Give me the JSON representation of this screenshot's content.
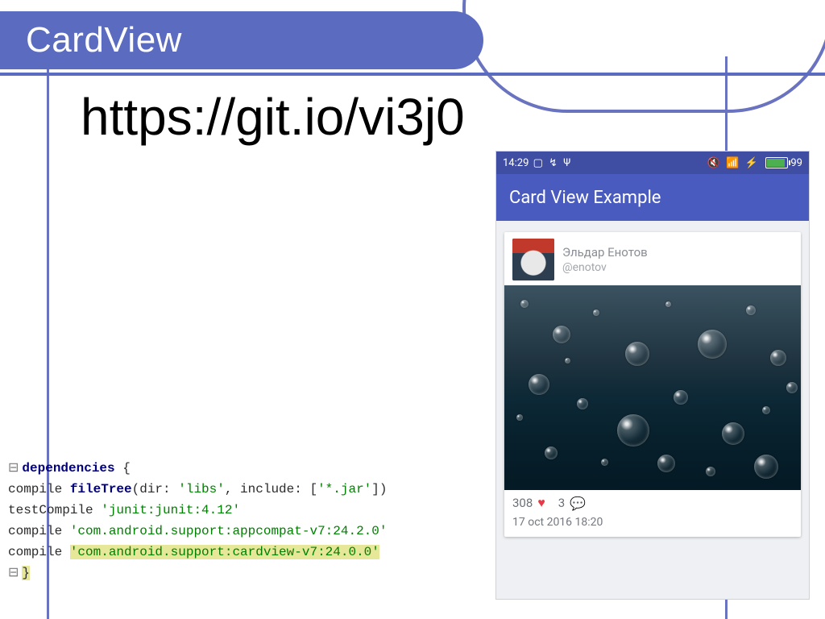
{
  "slide": {
    "title": "CardView",
    "url": "https://git.io/vi3j0"
  },
  "code": {
    "l1a": "dependencies",
    "l1b": " {",
    "l2a": "    compile ",
    "l2b": "fileTree",
    "l2c": "(dir: ",
    "l2d": "'libs'",
    "l2e": ", include: [",
    "l2f": "'*.jar'",
    "l2g": "])",
    "l3a": "    testCompile ",
    "l3b": "'junit:junit:4.12'",
    "l4a": "    compile ",
    "l4b": "'com.android.support:appcompat-v7:24.2.0'",
    "l5a": "    compile ",
    "l5b": "'com.android.support:cardview-v7:24.0.0'",
    "l6": "}"
  },
  "phone": {
    "status": {
      "time": "14:29",
      "battery": "99"
    },
    "appbar_title": "Card View Example",
    "card": {
      "username": "Эльдар Енотов",
      "handle": "@enotov",
      "likes": "308",
      "comments": "3",
      "date": "17 oct 2016 18:20"
    }
  }
}
